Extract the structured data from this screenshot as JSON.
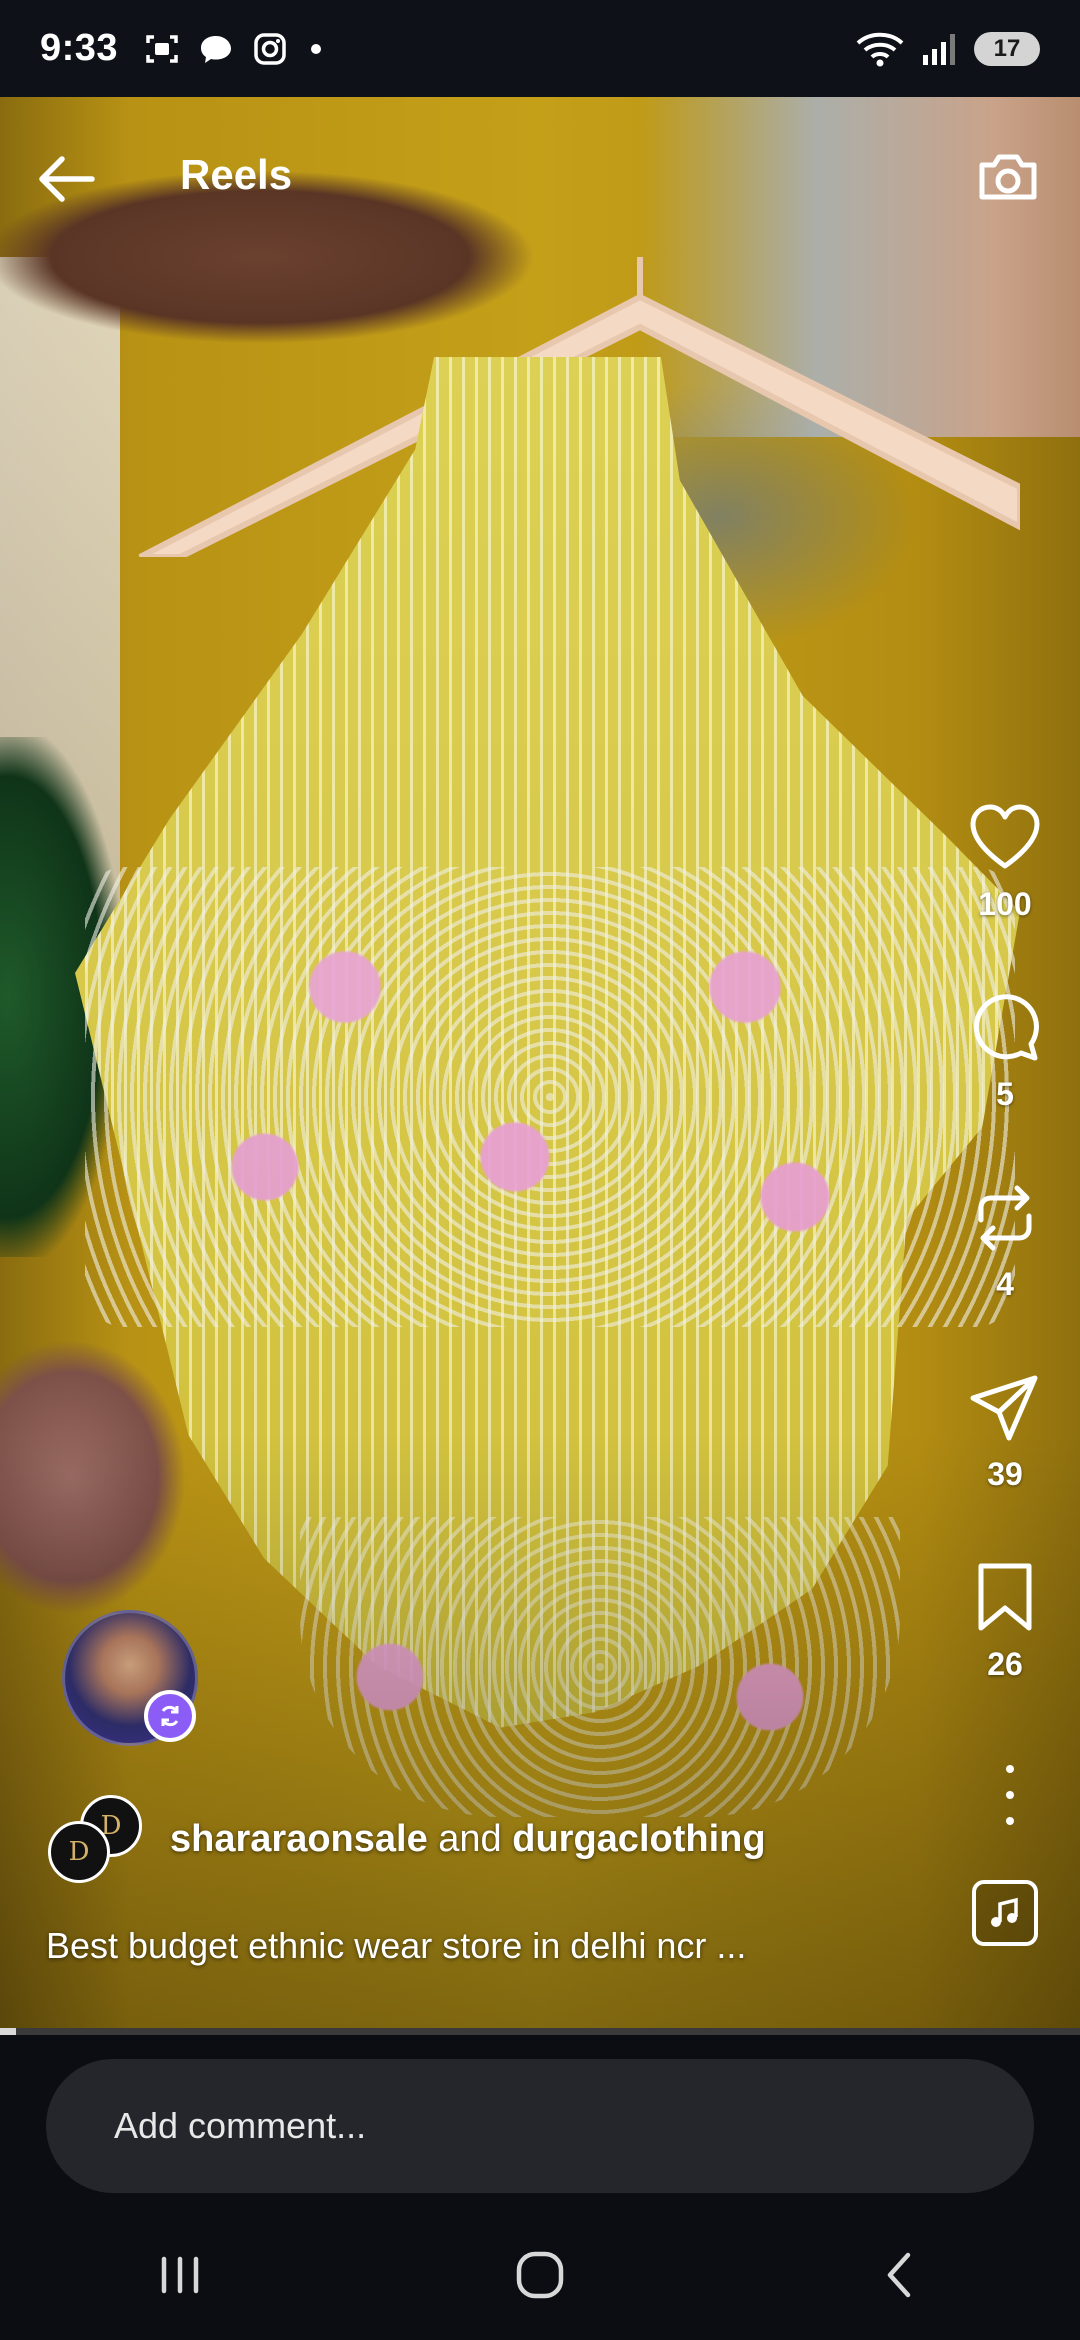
{
  "status_bar": {
    "time": "9:33",
    "battery": "17",
    "left_icons": [
      "screenshot-icon",
      "chat-bubble-icon",
      "instagram-icon",
      "dot-icon"
    ],
    "right_icons": [
      "wifi-icon",
      "signal-icon",
      "battery-icon"
    ]
  },
  "header": {
    "title": "Reels"
  },
  "actions": {
    "likes": "100",
    "comments": "5",
    "reposts": "4",
    "shares": "39",
    "saves": "26"
  },
  "author": {
    "primary": "shararaonsale",
    "connector": "and",
    "collaborator": "durgaclothing",
    "collab_monogram": "D"
  },
  "caption": "Best budget ethnic wear store in delhi ncr ...",
  "video": {
    "progress": 0.015
  },
  "comment": {
    "placeholder": "Add comment..."
  },
  "colors": {
    "accent_badge": "#8b5cf6",
    "status_bar_bg": "#0e1117",
    "bottom_bg": "#0b0d12",
    "comment_field_bg": "#25262b"
  }
}
